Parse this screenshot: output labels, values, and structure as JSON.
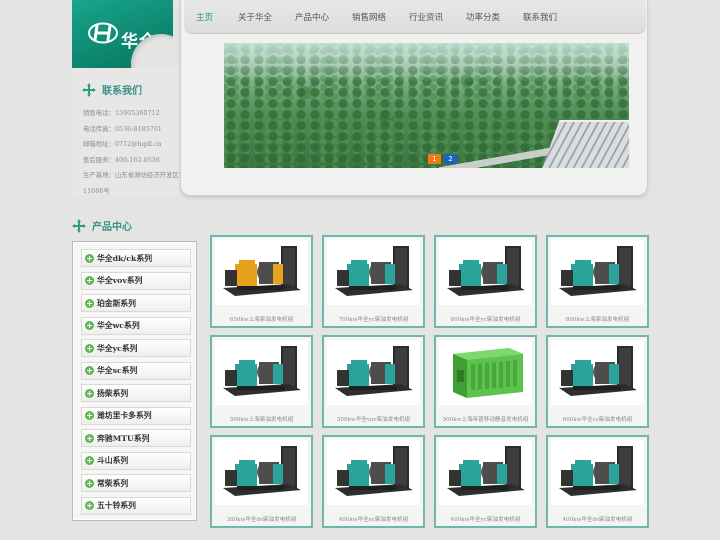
{
  "brand": {
    "name": "华全"
  },
  "nav": {
    "items": [
      {
        "label": "主页",
        "active": true
      },
      {
        "label": "关于华全",
        "active": false
      },
      {
        "label": "产品中心",
        "active": false
      },
      {
        "label": "销售网络",
        "active": false
      },
      {
        "label": "行业资讯",
        "active": false
      },
      {
        "label": "功率分类",
        "active": false
      },
      {
        "label": "联系我们",
        "active": false
      }
    ]
  },
  "contact": {
    "title": "联系我们",
    "lines": [
      "销售电话：15905360712",
      "电话传真：0536-8185701",
      "邮箱地址：0712@hqdl.cn",
      "售后服务：400-162-0536",
      "生产基地：山东省潍坊经济开发区古亭街",
      "11666号"
    ]
  },
  "banner": {
    "pages": [
      "1",
      "2"
    ],
    "active_page": "1"
  },
  "products_section": {
    "title": "产品中心"
  },
  "categories": [
    "华全dk/ck系列",
    "华全vov系列",
    "珀金斯系列",
    "华全wc系列",
    "华全yc系列",
    "华全sc系列",
    "扬柴系列",
    "潍坊里卡多系列",
    "奔驰MTU系列",
    "斗山系列",
    "常柴系列",
    "五十铃系列"
  ],
  "products": [
    {
      "caption": "650kw上海柴油发电机组",
      "style": "orange"
    },
    {
      "caption": "700kw华全yc柴油发电机组",
      "style": "teal"
    },
    {
      "caption": "800kw华全yc柴油发电机组",
      "style": "teal"
    },
    {
      "caption": "800kw上海柴油发电机组",
      "style": "teal"
    },
    {
      "caption": "500kw上海柴油发电机组",
      "style": "teal"
    },
    {
      "caption": "500kw华全vov柴油发电机组",
      "style": "teal"
    },
    {
      "caption": "500kw上海帝普移动静音发电机组",
      "style": "green-box"
    },
    {
      "caption": "600kw华全cs柴油发电机组",
      "style": "teal"
    },
    {
      "caption": "380kw华全ds柴油发电机组",
      "style": "teal"
    },
    {
      "caption": "400kw华全sc柴油发电机组",
      "style": "teal"
    },
    {
      "caption": "400kw华全yc柴油发电机组",
      "style": "teal"
    },
    {
      "caption": "400kw华全ds柴油发电机组",
      "style": "teal"
    }
  ],
  "colors": {
    "accent": "#1c9a7e",
    "engine_teal": "#2aa39a",
    "engine_orange": "#e6a21c",
    "enclosure_green": "#5cc34c",
    "card_border": "#6fb6b1"
  }
}
